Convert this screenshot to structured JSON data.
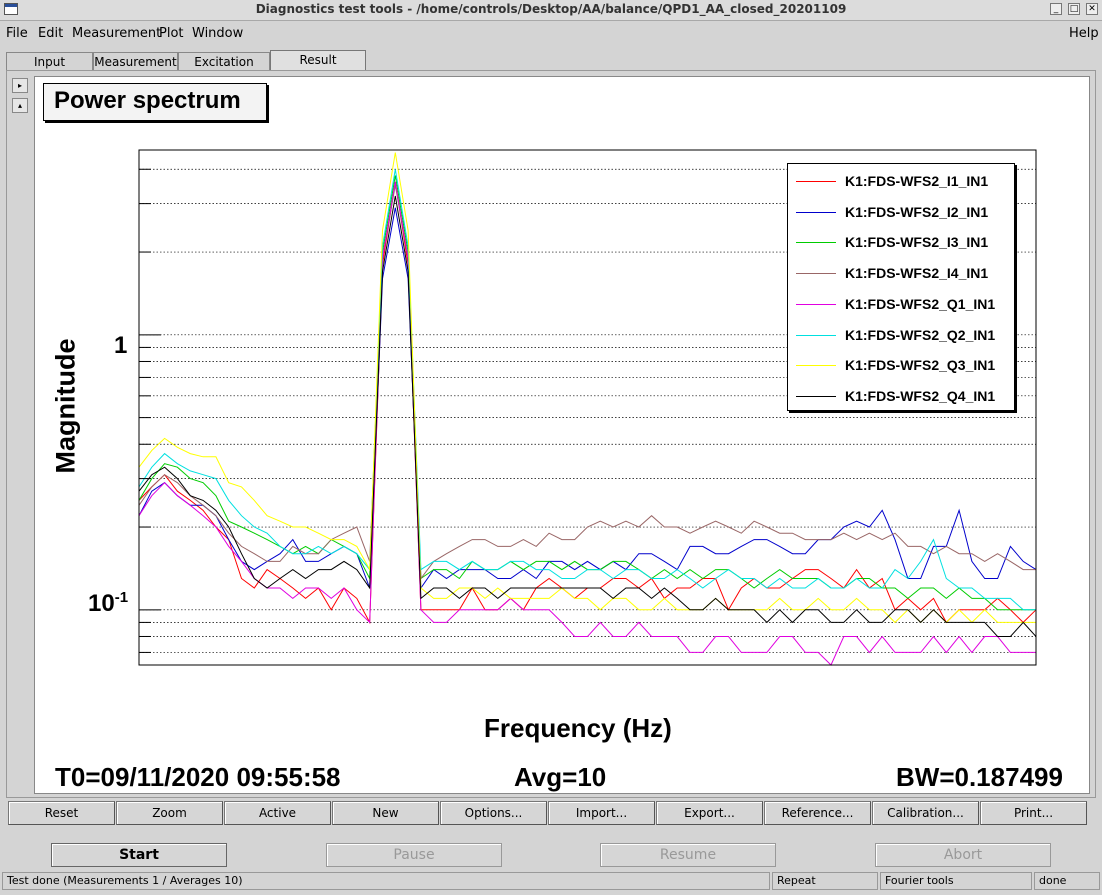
{
  "window": {
    "title": "Diagnostics test tools - /home/controls/Desktop/AA/balance/QPD1_AA_closed_20201109",
    "minimize": "_",
    "maximize": "□",
    "close": "✕"
  },
  "menu": {
    "file": "File",
    "edit": "Edit",
    "measurement": "Measurement",
    "plot": "Plot",
    "window": "Window",
    "help": "Help"
  },
  "tabs": [
    {
      "label": "Input"
    },
    {
      "label": "Measurement"
    },
    {
      "label": "Excitation"
    },
    {
      "label": "Result",
      "active": true
    }
  ],
  "side_buttons": {
    "expand": "▸",
    "collapse": "▴"
  },
  "plot": {
    "title": "Power spectrum",
    "ylabel": "Magnitude",
    "xlabel": "Frequency (Hz)",
    "tick_1": "1",
    "tick_01_base": "10",
    "tick_01_exp": "-1",
    "info_t0": "T0=09/11/2020 09:55:58",
    "info_avg": "Avg=10",
    "info_bw": "BW=0.187499"
  },
  "toolbar": [
    "Reset",
    "Zoom",
    "Active",
    "New",
    "Options...",
    "Import...",
    "Export...",
    "Reference...",
    "Calibration...",
    "Print..."
  ],
  "actions": {
    "start": "Start",
    "pause": "Pause",
    "resume": "Resume",
    "abort": "Abort"
  },
  "status": {
    "message": "Test done (Measurements 1 / Averages 10)",
    "mode": "Repeat",
    "tool": "Fourier tools",
    "state": "done"
  },
  "chart_data": {
    "type": "line",
    "title": "Power spectrum",
    "xlabel": "Frequency (Hz)",
    "ylabel": "Magnitude",
    "yscale": "log",
    "ylim": [
      0.063,
      4.7
    ],
    "grid": "horizontal",
    "legend_position": "top-right",
    "x": [
      0,
      1,
      2,
      3,
      4,
      5,
      6,
      7,
      8,
      9,
      10,
      11,
      12,
      13,
      14,
      15,
      16,
      17,
      18,
      19,
      20,
      21,
      22,
      23,
      24,
      25,
      26,
      27,
      28,
      29,
      30,
      31,
      32,
      33,
      34,
      35,
      36,
      37,
      38,
      39,
      40,
      41,
      42,
      43,
      44,
      45,
      46,
      47,
      48,
      49,
      50,
      51,
      52,
      53,
      54,
      55,
      56,
      57,
      58,
      59,
      60,
      61,
      62,
      63,
      64,
      65,
      66,
      67,
      68,
      69,
      70
    ],
    "series": [
      {
        "name": "K1:FDS-WFS2_I1_IN1",
        "color": "#ff0000",
        "values": [
          0.25,
          0.28,
          0.31,
          0.27,
          0.25,
          0.23,
          0.2,
          0.18,
          0.13,
          0.12,
          0.14,
          0.13,
          0.12,
          0.11,
          0.12,
          0.1,
          0.12,
          0.11,
          0.09,
          1.8,
          3.6,
          1.8,
          0.1,
          0.1,
          0.1,
          0.1,
          0.12,
          0.1,
          0.1,
          0.11,
          0.1,
          0.12,
          0.13,
          0.12,
          0.11,
          0.12,
          0.12,
          0.13,
          0.13,
          0.12,
          0.13,
          0.11,
          0.12,
          0.12,
          0.13,
          0.13,
          0.1,
          0.12,
          0.13,
          0.12,
          0.12,
          0.13,
          0.14,
          0.14,
          0.13,
          0.12,
          0.14,
          0.12,
          0.13,
          0.1,
          0.11,
          0.1,
          0.11,
          0.09,
          0.1,
          0.1,
          0.1,
          0.11,
          0.1,
          0.09,
          0.1
        ]
      },
      {
        "name": "K1:FDS-WFS2_I2_IN1",
        "color": "#0000cc",
        "values": [
          0.22,
          0.27,
          0.29,
          0.26,
          0.24,
          0.24,
          0.22,
          0.18,
          0.15,
          0.14,
          0.15,
          0.16,
          0.18,
          0.15,
          0.15,
          0.16,
          0.17,
          0.16,
          0.12,
          1.6,
          2.9,
          1.6,
          0.12,
          0.14,
          0.13,
          0.14,
          0.14,
          0.14,
          0.13,
          0.13,
          0.14,
          0.13,
          0.15,
          0.15,
          0.14,
          0.15,
          0.14,
          0.15,
          0.14,
          0.16,
          0.16,
          0.15,
          0.14,
          0.17,
          0.17,
          0.16,
          0.16,
          0.17,
          0.18,
          0.18,
          0.17,
          0.16,
          0.16,
          0.18,
          0.18,
          0.2,
          0.21,
          0.2,
          0.23,
          0.18,
          0.13,
          0.13,
          0.17,
          0.17,
          0.23,
          0.15,
          0.13,
          0.13,
          0.17,
          0.15,
          0.14
        ]
      },
      {
        "name": "K1:FDS-WFS2_I3_IN1",
        "color": "#00cc00",
        "values": [
          0.25,
          0.3,
          0.34,
          0.33,
          0.3,
          0.29,
          0.26,
          0.21,
          0.2,
          0.19,
          0.18,
          0.17,
          0.16,
          0.17,
          0.16,
          0.18,
          0.17,
          0.16,
          0.13,
          2.0,
          3.8,
          2.0,
          0.13,
          0.14,
          0.14,
          0.13,
          0.15,
          0.14,
          0.14,
          0.15,
          0.14,
          0.15,
          0.15,
          0.14,
          0.15,
          0.14,
          0.14,
          0.15,
          0.15,
          0.14,
          0.13,
          0.14,
          0.13,
          0.14,
          0.13,
          0.14,
          0.14,
          0.13,
          0.12,
          0.13,
          0.14,
          0.13,
          0.13,
          0.13,
          0.12,
          0.12,
          0.13,
          0.13,
          0.12,
          0.12,
          0.11,
          0.12,
          0.12,
          0.11,
          0.12,
          0.11,
          0.11,
          0.1,
          0.1,
          0.1,
          0.1
        ]
      },
      {
        "name": "K1:FDS-WFS2_I4_IN1",
        "color": "#996666",
        "values": [
          0.24,
          0.28,
          0.31,
          0.29,
          0.26,
          0.24,
          0.22,
          0.19,
          0.17,
          0.16,
          0.15,
          0.15,
          0.17,
          0.16,
          0.16,
          0.18,
          0.19,
          0.2,
          0.15,
          1.9,
          3.5,
          1.9,
          0.13,
          0.15,
          0.16,
          0.17,
          0.18,
          0.18,
          0.17,
          0.17,
          0.18,
          0.17,
          0.19,
          0.18,
          0.18,
          0.2,
          0.21,
          0.2,
          0.21,
          0.2,
          0.22,
          0.2,
          0.2,
          0.19,
          0.2,
          0.21,
          0.2,
          0.19,
          0.21,
          0.2,
          0.19,
          0.19,
          0.18,
          0.18,
          0.18,
          0.19,
          0.18,
          0.19,
          0.18,
          0.19,
          0.17,
          0.17,
          0.16,
          0.17,
          0.16,
          0.16,
          0.15,
          0.16,
          0.15,
          0.14,
          0.14
        ]
      },
      {
        "name": "K1:FDS-WFS2_Q1_IN1",
        "color": "#e000e0",
        "values": [
          0.22,
          0.26,
          0.29,
          0.26,
          0.24,
          0.22,
          0.2,
          0.17,
          0.15,
          0.13,
          0.12,
          0.12,
          0.11,
          0.12,
          0.12,
          0.11,
          0.12,
          0.1,
          0.09,
          1.9,
          3.6,
          1.9,
          0.1,
          0.09,
          0.09,
          0.1,
          0.1,
          0.1,
          0.1,
          0.11,
          0.1,
          0.1,
          0.1,
          0.09,
          0.08,
          0.08,
          0.09,
          0.08,
          0.08,
          0.09,
          0.08,
          0.08,
          0.08,
          0.07,
          0.07,
          0.08,
          0.08,
          0.07,
          0.07,
          0.07,
          0.08,
          0.08,
          0.07,
          0.07,
          0.06,
          0.08,
          0.08,
          0.07,
          0.08,
          0.07,
          0.07,
          0.07,
          0.08,
          0.07,
          0.08,
          0.07,
          0.08,
          0.08,
          0.07,
          0.07,
          0.07
        ]
      },
      {
        "name": "K1:FDS-WFS2_Q2_IN1",
        "color": "#00e0e0",
        "values": [
          0.28,
          0.33,
          0.37,
          0.34,
          0.32,
          0.31,
          0.3,
          0.25,
          0.22,
          0.2,
          0.19,
          0.17,
          0.16,
          0.16,
          0.17,
          0.16,
          0.17,
          0.16,
          0.14,
          2.1,
          4.0,
          2.1,
          0.14,
          0.15,
          0.15,
          0.14,
          0.15,
          0.14,
          0.14,
          0.15,
          0.15,
          0.14,
          0.14,
          0.13,
          0.13,
          0.14,
          0.14,
          0.13,
          0.14,
          0.14,
          0.13,
          0.13,
          0.14,
          0.13,
          0.12,
          0.13,
          0.14,
          0.13,
          0.13,
          0.12,
          0.13,
          0.12,
          0.12,
          0.13,
          0.12,
          0.12,
          0.13,
          0.12,
          0.12,
          0.14,
          0.13,
          0.15,
          0.18,
          0.13,
          0.12,
          0.12,
          0.11,
          0.11,
          0.11,
          0.1,
          0.1
        ]
      },
      {
        "name": "K1:FDS-WFS2_Q3_IN1",
        "color": "#ffff00",
        "values": [
          0.33,
          0.38,
          0.42,
          0.39,
          0.37,
          0.36,
          0.36,
          0.29,
          0.28,
          0.25,
          0.22,
          0.21,
          0.2,
          0.2,
          0.19,
          0.18,
          0.18,
          0.17,
          0.14,
          2.4,
          4.6,
          2.4,
          0.12,
          0.11,
          0.11,
          0.12,
          0.12,
          0.11,
          0.12,
          0.11,
          0.11,
          0.11,
          0.11,
          0.12,
          0.11,
          0.11,
          0.1,
          0.11,
          0.11,
          0.1,
          0.1,
          0.11,
          0.1,
          0.1,
          0.1,
          0.11,
          0.1,
          0.1,
          0.1,
          0.1,
          0.11,
          0.1,
          0.1,
          0.11,
          0.1,
          0.1,
          0.11,
          0.1,
          0.1,
          0.09,
          0.1,
          0.09,
          0.1,
          0.09,
          0.1,
          0.09,
          0.1,
          0.09,
          0.09,
          0.09,
          0.09
        ]
      },
      {
        "name": "K1:FDS-WFS2_Q4_IN1",
        "color": "#000000",
        "values": [
          0.27,
          0.31,
          0.33,
          0.3,
          0.26,
          0.25,
          0.23,
          0.2,
          0.16,
          0.13,
          0.12,
          0.13,
          0.14,
          0.13,
          0.14,
          0.14,
          0.15,
          0.14,
          0.12,
          1.7,
          3.2,
          1.7,
          0.11,
          0.12,
          0.12,
          0.11,
          0.12,
          0.12,
          0.11,
          0.12,
          0.12,
          0.12,
          0.12,
          0.12,
          0.12,
          0.12,
          0.12,
          0.11,
          0.12,
          0.12,
          0.11,
          0.12,
          0.11,
          0.1,
          0.1,
          0.11,
          0.1,
          0.1,
          0.1,
          0.09,
          0.1,
          0.09,
          0.1,
          0.1,
          0.09,
          0.09,
          0.1,
          0.09,
          0.09,
          0.1,
          0.1,
          0.09,
          0.1,
          0.09,
          0.09,
          0.09,
          0.09,
          0.08,
          0.08,
          0.09,
          0.08
        ]
      }
    ]
  }
}
